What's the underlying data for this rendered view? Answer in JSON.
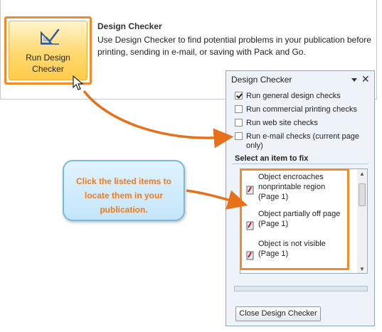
{
  "info": {
    "run_button_line1": "Run Design",
    "run_button_line2": "Checker",
    "title": "Design Checker",
    "description": "Use Design Checker to find potential problems in your publication before printing, sending in e-mail, or saving with Pack and Go."
  },
  "pane": {
    "title": "Design Checker",
    "close_glyph": "✕",
    "checks": [
      {
        "label": "Run general design checks",
        "checked": true
      },
      {
        "label": "Run commercial printing checks",
        "checked": false
      },
      {
        "label": "Run web site checks",
        "checked": false
      },
      {
        "label": "Run e-mail checks (current page only)",
        "checked": false
      }
    ],
    "section_label": "Select an item to fix",
    "items": [
      {
        "text": "Object encroaches nonprintable region (Page 1)",
        "icon": "warning-object-icon"
      },
      {
        "text": "Object partially off page (Page 1)",
        "icon": "warning-object-icon"
      },
      {
        "text": "Object is not visible (Page 1)",
        "icon": "warning-object-icon"
      }
    ],
    "close_button": "Close Design Checker"
  },
  "callout": {
    "text": "Click the listed items to locate them in your publication."
  },
  "colors": {
    "highlight": "#f08a2a",
    "callout_text": "#f07a1a",
    "callout_fill": "#c4e6fa",
    "pane_bg": "#eef3fa"
  }
}
